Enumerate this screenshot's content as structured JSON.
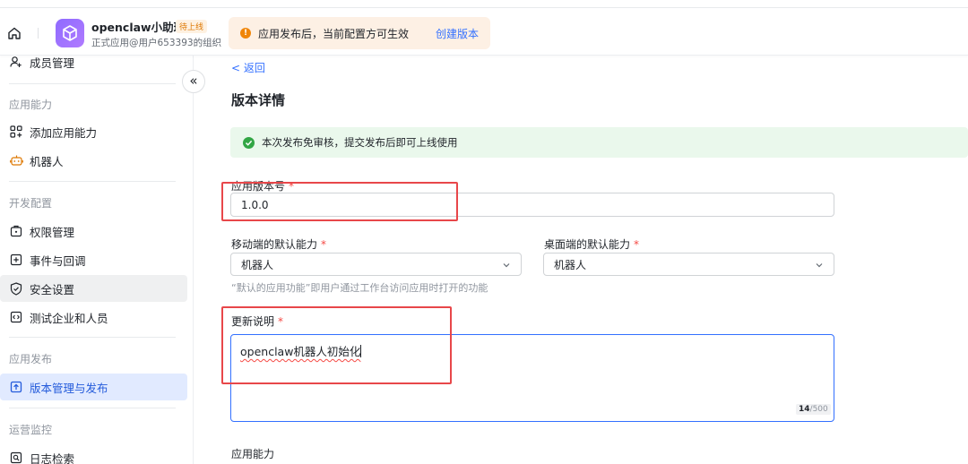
{
  "header": {
    "app_name": "openclaw小助理",
    "app_status_badge": "待上线",
    "app_subtitle": "正式应用@用户653393的组织",
    "notice_text": "应用发布后，当前配置方可生效",
    "notice_action": "创建版本",
    "notice_icon": "!"
  },
  "sidebar": {
    "top_item": "成员管理",
    "sections": [
      {
        "title": "应用能力",
        "items": [
          "添加应用能力",
          "机器人"
        ]
      },
      {
        "title": "开发配置",
        "items": [
          "权限管理",
          "事件与回调",
          "安全设置",
          "测试企业和人员"
        ]
      },
      {
        "title": "应用发布",
        "items": [
          "版本管理与发布"
        ]
      },
      {
        "title": "运营监控",
        "items": [
          "日志检索"
        ]
      }
    ],
    "collapse_icon": "«"
  },
  "main": {
    "back_link": "< 返回",
    "page_title": "版本详情",
    "success_message": "本次发布免审核，提交发布后即可上线使用",
    "version_label": "应用版本号",
    "version_value": "1.0.0",
    "mobile_label": "移动端的默认能力",
    "mobile_value": "机器人",
    "desktop_label": "桌面端的默认能力",
    "desktop_value": "机器人",
    "hint": "“默认的应用功能”即用户通过工作台访问应用时打开的功能",
    "notes_label": "更新说明",
    "notes_value": "openclaw机器人初始化",
    "char_count": "14",
    "char_max": "/500",
    "capability_label": "应用能力",
    "required_mark": "*"
  },
  "colors": {
    "accent": "#3370ff",
    "warning": "#f0860a",
    "success": "#32a645",
    "annotation_red": "#e8474a"
  }
}
